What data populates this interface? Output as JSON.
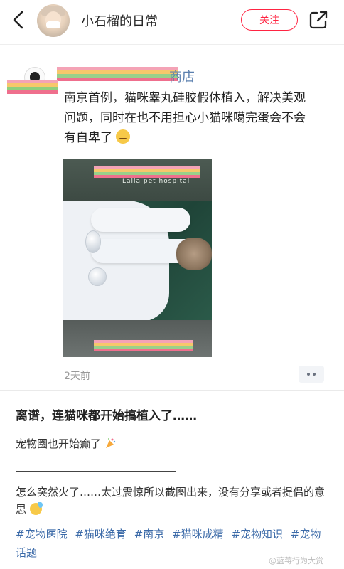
{
  "header": {
    "username": "小石榴的日常",
    "follow_label": "关注"
  },
  "embed": {
    "shop_name_visible": "商店",
    "text": "南京首例，猫咪睾丸硅胶假体植入，解决美观问题，同时在也不用担心小猫咪噶完蛋会不会有自卑了",
    "photo_caption": "Laila pet hospital",
    "time": "2天前"
  },
  "post": {
    "title": "离谱，连猫咪都开始搞植入了……",
    "line1": "宠物圈也开始癫了",
    "body": "怎么突然火了……太过震惊所以截图出来，没有分享或者提倡的意思",
    "tags": [
      "#宠物医院",
      "#猫咪绝育",
      "#南京",
      "#猫咪成精",
      "#宠物知识",
      "#宠物话题"
    ]
  },
  "watermark": "@蓝莓行为大赏",
  "colors": {
    "accent": "#ff2442",
    "tag": "#3b6aa8"
  }
}
